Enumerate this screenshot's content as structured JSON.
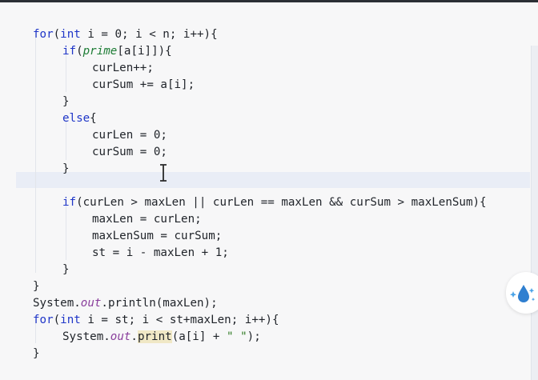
{
  "code_lines": [
    {
      "id": "l1",
      "tokens": [
        {
          "t": "kw",
          "v": "for"
        },
        {
          "t": "p",
          "v": "("
        },
        {
          "t": "kw",
          "v": "int"
        },
        {
          "t": "p",
          "v": " i = 0; i < n; i++){"
        }
      ]
    },
    {
      "id": "l2",
      "tokens": [
        {
          "t": "kw",
          "v": "if"
        },
        {
          "t": "p",
          "v": "("
        },
        {
          "t": "fn",
          "v": "prime"
        },
        {
          "t": "p",
          "v": "[a[i]]){"
        }
      ]
    },
    {
      "id": "l3",
      "tokens": [
        {
          "t": "p",
          "v": "curLen++;"
        }
      ]
    },
    {
      "id": "l4",
      "tokens": [
        {
          "t": "p",
          "v": "curSum += a[i];"
        }
      ]
    },
    {
      "id": "l5",
      "tokens": [
        {
          "t": "p",
          "v": "}"
        }
      ]
    },
    {
      "id": "l6",
      "tokens": [
        {
          "t": "kw",
          "v": "else"
        },
        {
          "t": "p",
          "v": "{"
        }
      ]
    },
    {
      "id": "l7",
      "tokens": [
        {
          "t": "p",
          "v": "curLen = 0;"
        }
      ]
    },
    {
      "id": "l8",
      "tokens": [
        {
          "t": "p",
          "v": "curSum = 0;"
        }
      ]
    },
    {
      "id": "l9",
      "tokens": [
        {
          "t": "p",
          "v": "}"
        }
      ]
    },
    {
      "id": "l10",
      "tokens": [
        {
          "t": "kw",
          "v": "if"
        },
        {
          "t": "p",
          "v": "(curLen > maxLen || curLen == maxLen && curSum > maxLenSum){"
        }
      ]
    },
    {
      "id": "l11",
      "tokens": [
        {
          "t": "p",
          "v": "maxLen = curLen;"
        }
      ]
    },
    {
      "id": "l12",
      "tokens": [
        {
          "t": "p",
          "v": "maxLenSum = curSum;"
        }
      ]
    },
    {
      "id": "l13",
      "tokens": [
        {
          "t": "p",
          "v": "st = i - maxLen + 1;"
        }
      ]
    },
    {
      "id": "l14",
      "tokens": [
        {
          "t": "p",
          "v": "}"
        }
      ]
    },
    {
      "id": "l15",
      "tokens": [
        {
          "t": "p",
          "v": "}"
        }
      ]
    },
    {
      "id": "l16",
      "tokens": [
        {
          "t": "p",
          "v": "System."
        },
        {
          "t": "st",
          "v": "out"
        },
        {
          "t": "p",
          "v": ".println(maxLen);"
        }
      ]
    },
    {
      "id": "l17",
      "tokens": [
        {
          "t": "kw",
          "v": "for"
        },
        {
          "t": "p",
          "v": "("
        },
        {
          "t": "kw",
          "v": "int"
        },
        {
          "t": "p",
          "v": " i = st; i < st+maxLen; i++){"
        }
      ]
    },
    {
      "id": "l18",
      "tokens": [
        {
          "t": "p",
          "v": "System."
        },
        {
          "t": "st",
          "v": "out"
        },
        {
          "t": "p",
          "v": "."
        },
        {
          "t": "hl",
          "v": "print"
        },
        {
          "t": "p",
          "v": "(a[i] + "
        },
        {
          "t": "str",
          "v": "\" \""
        },
        {
          "t": "p",
          "v": ");"
        }
      ]
    },
    {
      "id": "l19",
      "tokens": [
        {
          "t": "p",
          "v": "}"
        }
      ]
    }
  ],
  "icons": {
    "cursor": "text-cursor-icon",
    "floating_button": "water-drop-sparkle-icon"
  },
  "colors": {
    "keyword": "#1f36c8",
    "method_italic": "#1c7c34",
    "static_field": "#8a3f9c",
    "string": "#2f7a22",
    "current_line": "#e9edf6",
    "background": "#f7f7f8"
  }
}
